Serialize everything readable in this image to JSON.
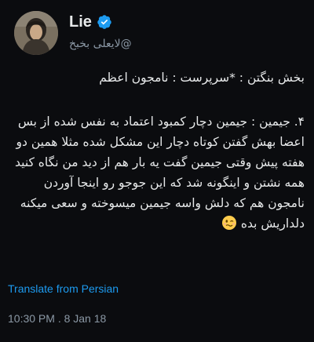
{
  "user": {
    "display_name": "Lie",
    "handle": "@لایعلی بخبخ",
    "verified_icon": "verified-badge-icon",
    "avatar_icon": "profile-avatar-image"
  },
  "tweet": {
    "line1": "بخش بنگتن : *سرپرست : نامجون اعظم",
    "paragraph2": "۴. جیمین : جیمین دچار کمبود اعتماد به نفس شده از بس اعضا بهش گفتن کوتاه دچار این مشکل شده مثلا همین دو هفته پیش وقتی جیمین گفت یه بار هم از دید من نگاه کنید همه نشتن و اینگونه شد که این جوجو رو اینجا آوردن نامجون هم که دلش واسه جیمین میسوخته و سعی میکنه دلداریش بده",
    "emoji_icon": "woozy-face-emoji"
  },
  "translate_label": "Translate from Persian",
  "timestamp": "10:30 PM . 8 Jan 18",
  "colors": {
    "background": "#0b0c0f",
    "text": "#e7e9ea",
    "secondary": "#8b98a5",
    "link": "#1d9bf0",
    "verified": "#1d9bf0"
  }
}
